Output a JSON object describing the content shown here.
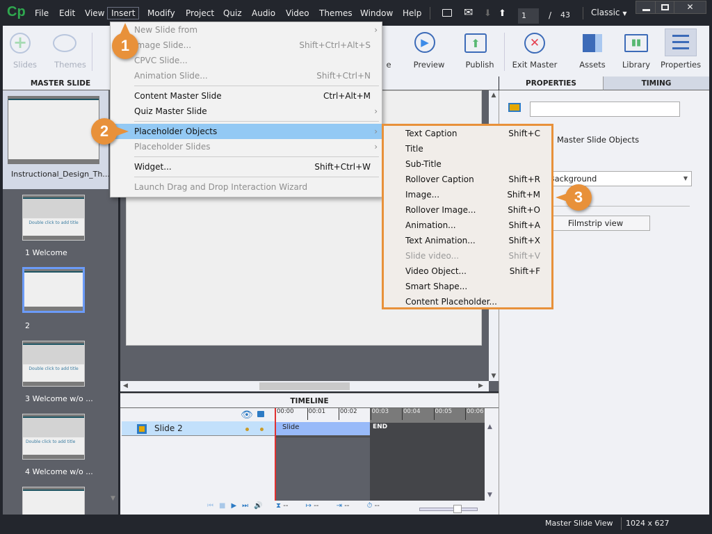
{
  "app": {
    "logo": "Cp"
  },
  "menubar": [
    "File",
    "Edit",
    "View",
    "Insert",
    "Modify",
    "Project",
    "Quiz",
    "Audio",
    "Video",
    "Themes",
    "Window",
    "Help"
  ],
  "nav": {
    "current_slide": "1",
    "separator": "/",
    "total_slides": "43",
    "workspace": "Classic"
  },
  "toolbar": {
    "slides": "Slides",
    "themes": "Themes",
    "save_partial": "e",
    "preview": "Preview",
    "publish": "Publish",
    "exit_master": "Exit Master",
    "assets": "Assets",
    "library": "Library",
    "properties": "Properties"
  },
  "panels": {
    "master_slide": "MASTER SLIDE",
    "properties": "PROPERTIES",
    "timing": "TIMING",
    "timeline": "TIMELINE"
  },
  "filmstrip": {
    "master": {
      "label": "Instructional_Design_Th..."
    },
    "slides": [
      {
        "label": "1 Welcome",
        "thumb_title": "Double click to add title"
      },
      {
        "label": "2",
        "thumb_title": ""
      },
      {
        "label": "3 Welcome w/o ...",
        "thumb_title": "Double click to add title"
      },
      {
        "label": "4 Welcome w/o ...",
        "thumb_title": "Double click to add title"
      }
    ]
  },
  "insert_menu": {
    "items": [
      {
        "label": "New Slide from",
        "shortcut": "",
        "submenu": true,
        "disabled": true
      },
      {
        "label": "Image Slide...",
        "shortcut": "Shift+Ctrl+Alt+S",
        "disabled": true
      },
      {
        "label": "CPVC Slide...",
        "shortcut": "",
        "disabled": true
      },
      {
        "label": "Animation Slide...",
        "shortcut": "Shift+Ctrl+N",
        "disabled": true
      },
      {
        "label": "Content Master Slide",
        "shortcut": "Ctrl+Alt+M"
      },
      {
        "label": "Quiz Master Slide",
        "shortcut": "",
        "submenu": true
      },
      {
        "label": "Placeholder Objects",
        "shortcut": "",
        "submenu": true,
        "highlighted": true
      },
      {
        "label": "Placeholder Slides",
        "shortcut": "",
        "submenu": true,
        "disabled": true
      },
      {
        "label": "Widget...",
        "shortcut": "Shift+Ctrl+W"
      },
      {
        "label": "Launch Drag and Drop Interaction Wizard",
        "shortcut": "",
        "disabled": true
      }
    ]
  },
  "placeholder_submenu": [
    {
      "label": "Text Caption",
      "shortcut": "Shift+C"
    },
    {
      "label": "Title",
      "shortcut": ""
    },
    {
      "label": "Sub-Title",
      "shortcut": ""
    },
    {
      "label": "Rollover Caption",
      "shortcut": "Shift+R"
    },
    {
      "label": "Image...",
      "shortcut": "Shift+M"
    },
    {
      "label": "Rollover Image...",
      "shortcut": "Shift+O"
    },
    {
      "label": "Animation...",
      "shortcut": "Shift+A"
    },
    {
      "label": "Text Animation...",
      "shortcut": "Shift+X"
    },
    {
      "label": "Slide video...",
      "shortcut": "Shift+V",
      "disabled": true
    },
    {
      "label": "Video Object...",
      "shortcut": "Shift+F"
    },
    {
      "label": "Smart Shape...",
      "shortcut": ""
    },
    {
      "label": "Content Placeholder...",
      "shortcut": ""
    }
  ],
  "callouts": [
    "1",
    "2",
    "3"
  ],
  "properties": {
    "name_value": "",
    "master_objects": "Master Slide Objects",
    "background_select": "e Background",
    "filmstrip_button": "Filmstrip view"
  },
  "timeline": {
    "layer": "Slide 2",
    "slide_bar": "Slide",
    "end_label": "END",
    "ticks": [
      "00:00",
      "00:01",
      "00:02",
      "00:03",
      "00:04",
      "00:05",
      "00:06"
    ],
    "readouts": [
      "--",
      "--",
      "--",
      "--"
    ]
  },
  "status": {
    "view": "Master Slide View",
    "size": "1024 x 627"
  },
  "colors": {
    "accent_orange": "#e8913a",
    "highlight": "#93c9f4",
    "titlebar": "#23262d"
  }
}
